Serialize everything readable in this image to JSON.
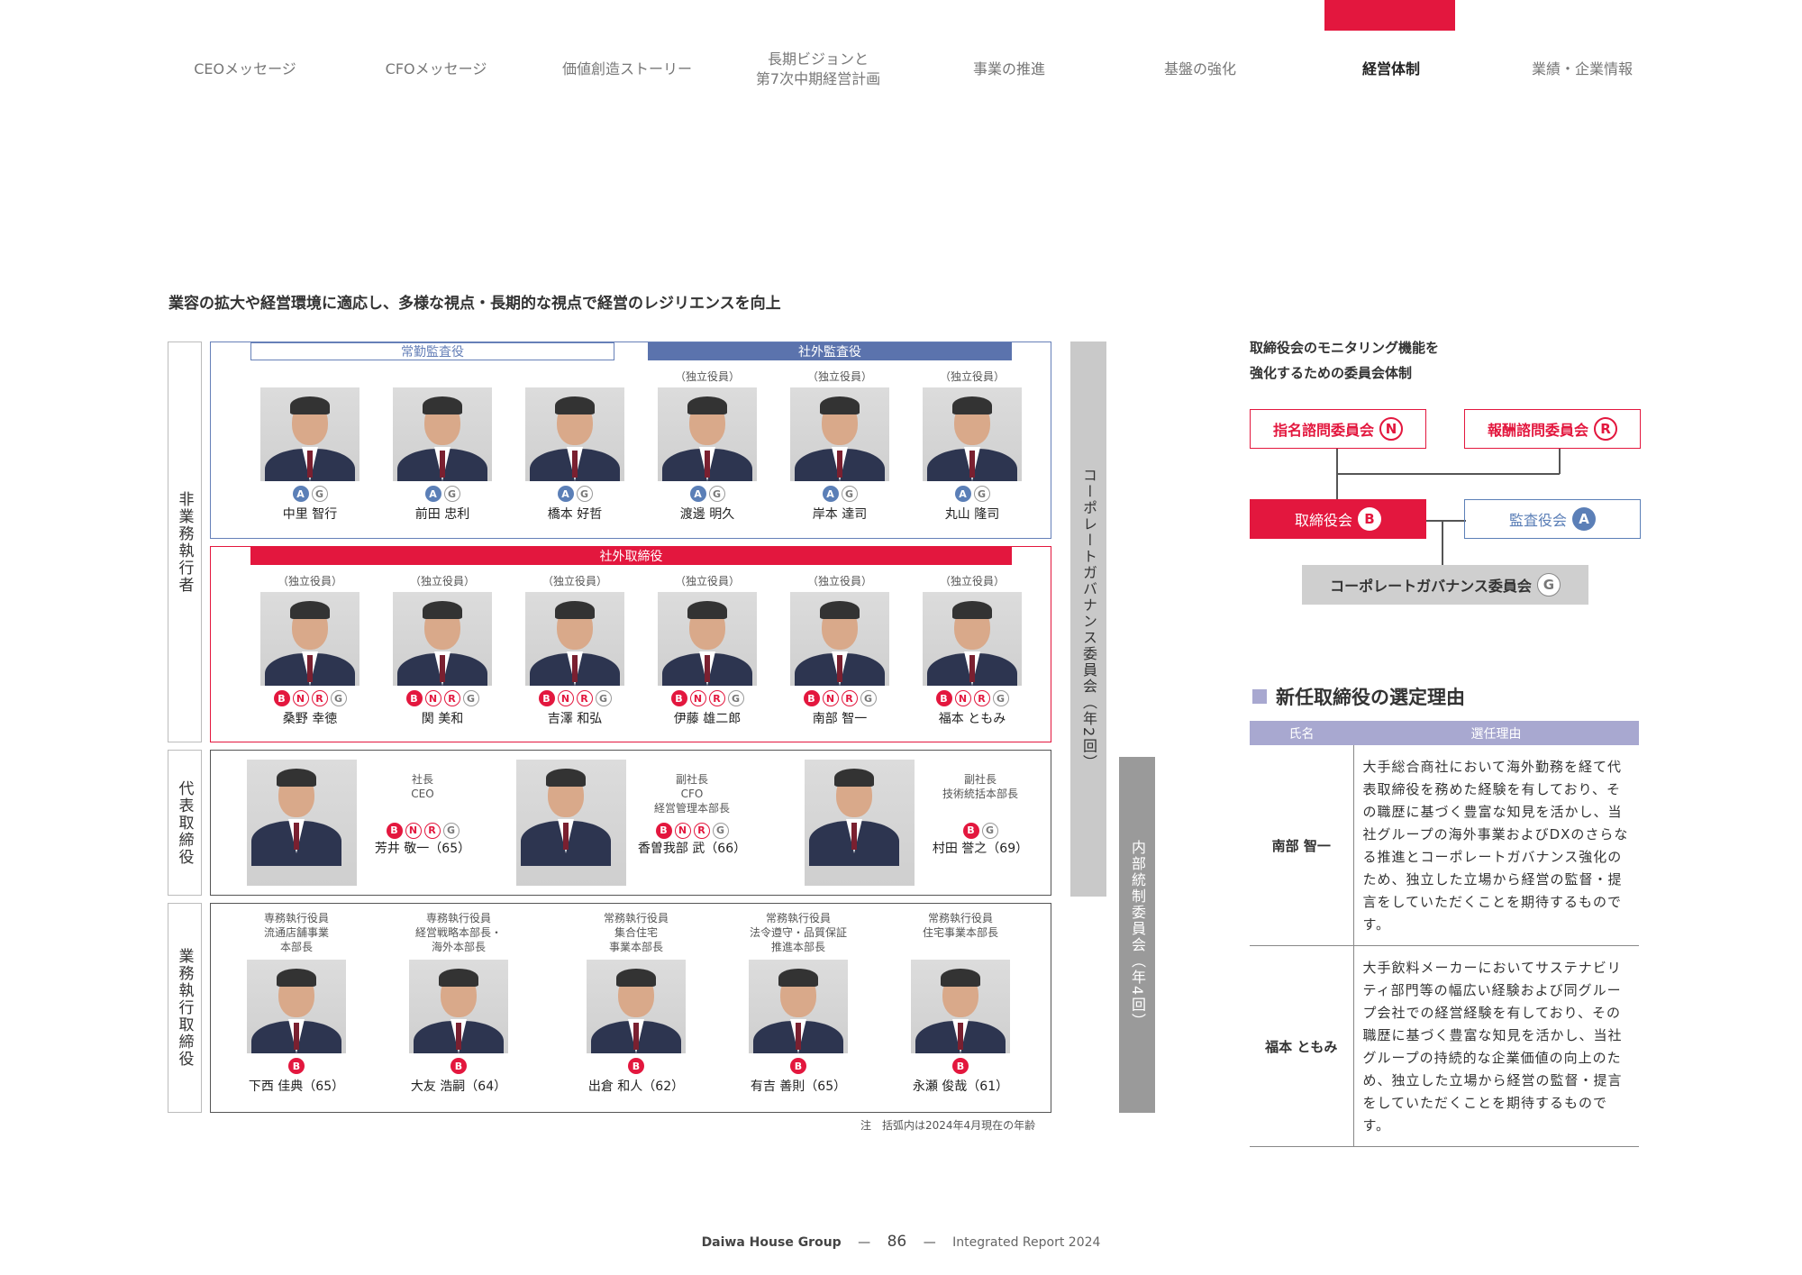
{
  "nav": {
    "items": [
      {
        "label": "CEOメッセージ"
      },
      {
        "label": "CFOメッセージ"
      },
      {
        "label": "価値創造ストーリー"
      },
      {
        "label": "長期ビジョンと\n第7次中期経営計画"
      },
      {
        "label": "事業の推進"
      },
      {
        "label": "基盤の強化"
      },
      {
        "label": "経営体制",
        "active": true
      },
      {
        "label": "業績・企業情報"
      }
    ],
    "accent": "#e3173e"
  },
  "headline": "業容の拡大や経営環境に適応し、多様な視点・長期的な視点で経営のレジリエンスを向上",
  "side_labels": {
    "non_exec": "非業務執行者",
    "rep": "代表取締役",
    "exec": "業務執行取締役"
  },
  "auditors": {
    "standing_label": "常勤監査役",
    "outside_label": "社外監査役",
    "people": [
      {
        "tag": "",
        "badges": [
          "A",
          "G"
        ],
        "name": "中里 智行"
      },
      {
        "tag": "",
        "badges": [
          "A",
          "G"
        ],
        "name": "前田 忠利"
      },
      {
        "tag": "",
        "badges": [
          "A",
          "G"
        ],
        "name": "橋本 好哲"
      },
      {
        "tag": "（独立役員）",
        "badges": [
          "A",
          "G"
        ],
        "name": "渡邊 明久"
      },
      {
        "tag": "（独立役員）",
        "badges": [
          "A",
          "G"
        ],
        "name": "岸本 達司"
      },
      {
        "tag": "（独立役員）",
        "badges": [
          "A",
          "G"
        ],
        "name": "丸山 隆司"
      }
    ]
  },
  "outside_directors": {
    "label": "社外取締役",
    "people": [
      {
        "tag": "（独立役員）",
        "badges": [
          "B",
          "N",
          "R",
          "G"
        ],
        "name": "桑野 幸徳"
      },
      {
        "tag": "（独立役員）",
        "badges": [
          "B",
          "N",
          "R",
          "G"
        ],
        "name": "関 美和"
      },
      {
        "tag": "（独立役員）",
        "badges": [
          "B",
          "N",
          "R",
          "G"
        ],
        "name": "吉澤 和弘"
      },
      {
        "tag": "（独立役員）",
        "badges": [
          "B",
          "N",
          "R",
          "G"
        ],
        "name": "伊藤 雄二郎"
      },
      {
        "tag": "（独立役員）",
        "badges": [
          "B",
          "N",
          "R",
          "G"
        ],
        "name": "南部 智一"
      },
      {
        "tag": "（独立役員）",
        "badges": [
          "B",
          "N",
          "R",
          "G"
        ],
        "name": "福本 ともみ"
      }
    ]
  },
  "representatives": [
    {
      "title": "社長\nCEO",
      "badges": [
        "B",
        "N",
        "R",
        "G"
      ],
      "name": "芳井 敬一（65）"
    },
    {
      "title": "副社長\nCFO\n経営管理本部長",
      "badges": [
        "B",
        "N",
        "R",
        "G"
      ],
      "name": "香曽我部 武（66）"
    },
    {
      "title": "副社長\n技術統括本部長",
      "badges": [
        "B",
        "G"
      ],
      "name": "村田 誉之（69）"
    }
  ],
  "executives": [
    {
      "title": "専務執行役員\n流通店舗事業\n本部長",
      "badges": [
        "B"
      ],
      "name": "下西 佳典（65）"
    },
    {
      "title": "専務執行役員\n経営戦略本部長・\n海外本部長",
      "badges": [
        "B"
      ],
      "name": "大友 浩嗣（64）"
    },
    {
      "title": "常務執行役員\n集合住宅\n事業本部長",
      "badges": [
        "B"
      ],
      "name": "出倉 和人（62）"
    },
    {
      "title": "常務執行役員\n法令遵守・品質保証\n推進本部長",
      "badges": [
        "B"
      ],
      "name": "有吉 善則（65）"
    },
    {
      "title": "常務執行役員\n住宅事業本部長",
      "badges": [
        "B"
      ],
      "name": "永瀬 俊哉（61）"
    }
  ],
  "vertical_bars": {
    "governance": "コーポレートガバナンス委員会（年2回）",
    "internal": "内部統制委員会（年4回）"
  },
  "note": "注　括弧内は2024年4月現在の年齢",
  "committee": {
    "title": "取締役会のモニタリング機能を\n強化するための委員会体制",
    "nomination": "指名諮問委員会",
    "remuneration": "報酬諮問委員会",
    "board": "取締役会",
    "audit": "監査役会",
    "governance": "コーポレートガバナンス委員会",
    "letters": {
      "N": "N",
      "R": "R",
      "B": "B",
      "A": "A",
      "G": "G"
    }
  },
  "selection": {
    "title": "新任取締役の選定理由",
    "col_name": "氏名",
    "col_reason": "選任理由",
    "rows": [
      {
        "name": "南部 智一",
        "reason": "大手総合商社において海外勤務を経て代表取締役を務めた経験を有しており、その職歴に基づく豊富な知見を活かし、当社グループの海外事業およびDXのさらなる推進とコーポレートガバナンス強化のため、独立した立場から経営の監督・提言をしていただくことを期待するものです。"
      },
      {
        "name": "福本 ともみ",
        "reason": "大手飲料メーカーにおいてサステナビリティ部門等の幅広い経験および同グループ会社での経営経験を有しており、その職歴に基づく豊富な知見を活かし、当社グループの持続的な企業価値の向上のため、独立した立場から経営の監督・提言をしていただくことを期待するものです。"
      }
    ]
  },
  "footer": {
    "brand": "Daiwa House Group",
    "sep": "—",
    "page": "86",
    "report": "Integrated Report 2024"
  }
}
